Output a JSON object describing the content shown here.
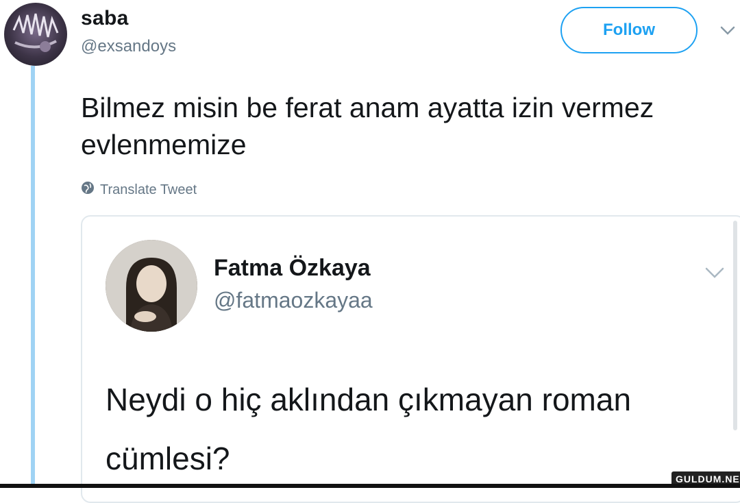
{
  "tweet": {
    "author": {
      "name": "saba",
      "handle": "@exsandoys"
    },
    "follow_label": "Follow",
    "text": "Bilmez misin be ferat anam ayatta izin vermez evlenmemize",
    "translate_label": "Translate Tweet",
    "icons": {
      "menu": "chevron-down-icon",
      "translate": "globe-icon"
    }
  },
  "quoted_tweet": {
    "author": {
      "name": "Fatma Özkaya",
      "handle": "@fatmaozkayaa"
    },
    "text": "Neydi o hiç aklından çıkmayan roman cümlesi?"
  },
  "watermark": "GULDUM.NET",
  "colors": {
    "accent": "#1da1f2",
    "thread_line": "#9fd3f4",
    "secondary_text": "#657786"
  }
}
